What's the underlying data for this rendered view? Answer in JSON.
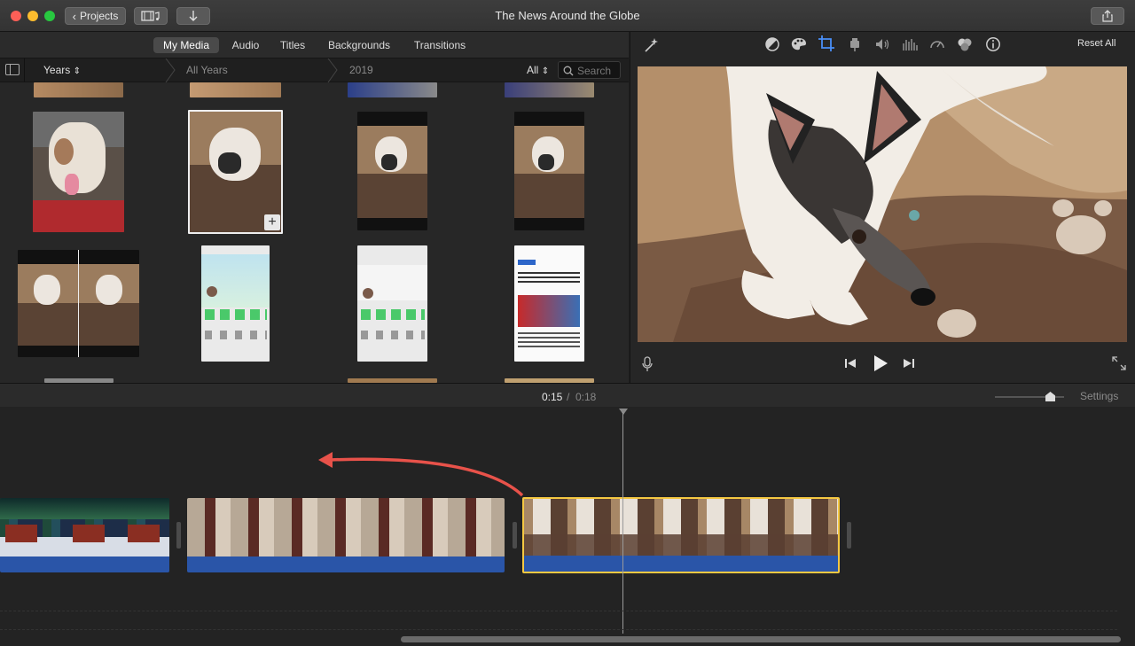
{
  "window": {
    "title": "The News Around the Globe"
  },
  "toolbar": {
    "projects_label": "Projects",
    "back_icon": "chevron-left-icon",
    "library_icon": "film-music-icon",
    "import_icon": "download-arrow-icon",
    "share_icon": "share-icon"
  },
  "browser": {
    "tabs": [
      {
        "label": "My Media",
        "active": true
      },
      {
        "label": "Audio",
        "active": false
      },
      {
        "label": "Titles",
        "active": false
      },
      {
        "label": "Backgrounds",
        "active": false
      },
      {
        "label": "Transitions",
        "active": false
      }
    ],
    "filter": {
      "sort_label": "Years",
      "crumb_all_years": "All Years",
      "crumb_year": "2019",
      "filter_label": "All",
      "search_placeholder": "Search"
    }
  },
  "viewer": {
    "adjust_icons": [
      "magic-wand-icon",
      "color-balance-icon",
      "color-palette-icon",
      "crop-icon",
      "stabilization-icon",
      "volume-icon",
      "noise-reduction-icon",
      "speed-icon",
      "clip-filter-icon",
      "info-icon"
    ],
    "reset_all_label": "Reset All"
  },
  "playback": {
    "current_time": "0:15",
    "separator": "/",
    "total_time": "0:18",
    "settings_label": "Settings"
  },
  "timeline": {
    "clips": [
      {
        "name": "aurora-cabin-clip",
        "selected": false
      },
      {
        "name": "cat-door-clip",
        "selected": false
      },
      {
        "name": "dog-clip",
        "selected": true
      }
    ]
  },
  "colors": {
    "accent": "#3b82f6",
    "selection": "#f5c842",
    "audio": "#2a55a8",
    "arrow": "#e8524a"
  }
}
